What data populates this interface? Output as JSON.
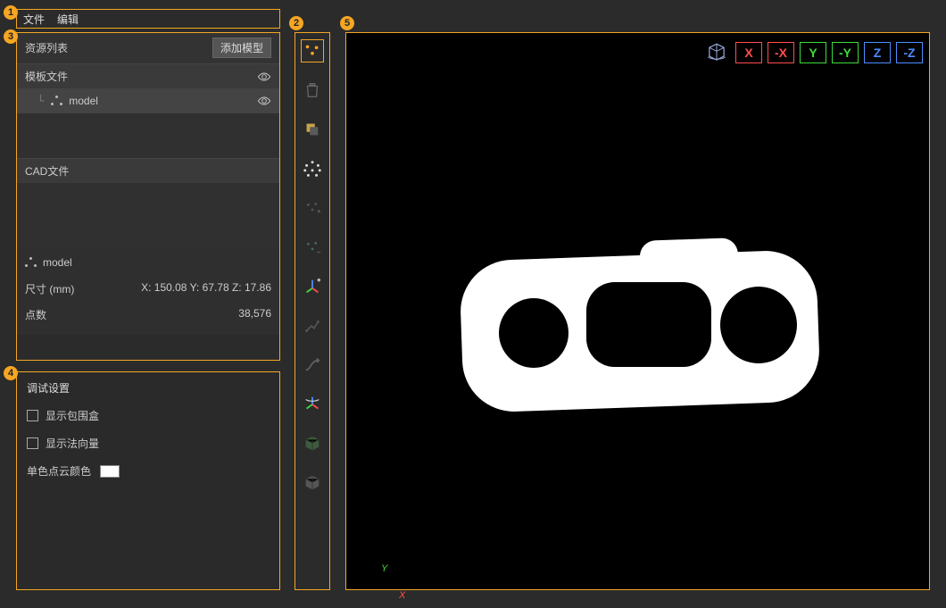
{
  "callouts": {
    "c1": "1",
    "c2": "2",
    "c3": "3",
    "c4": "4",
    "c5": "5"
  },
  "menu": {
    "file": "文件",
    "edit": "编辑"
  },
  "resource": {
    "title": "资源列表",
    "addBtn": "添加模型",
    "templatesHeader": "模板文件",
    "modelItem": "model",
    "cadHeader": "CAD文件"
  },
  "info": {
    "modelName": "model",
    "sizeLabel": "尺寸 (mm)",
    "sizeValue": "X: 150.08 Y: 67.78 Z: 17.86",
    "pointsLabel": "点数",
    "pointsValue": "38,576"
  },
  "debug": {
    "title": "调试设置",
    "showBBox": "显示包围盒",
    "showNormals": "显示法向量",
    "monoColorLabel": "单色点云颜色",
    "monoColor": "#ffffff"
  },
  "toolbarIcons": [
    "select-points",
    "trash",
    "layer",
    "sample-sparse",
    "add-points",
    "subtract-points",
    "axes-add",
    "transform",
    "curve",
    "axes-orbit",
    "cube-solid",
    "cube-wire"
  ],
  "axes": {
    "cube": "orbit-cube",
    "buttons": [
      {
        "k": "X",
        "cls": "axX"
      },
      {
        "k": "-X",
        "cls": "axX"
      },
      {
        "k": "Y",
        "cls": "axY"
      },
      {
        "k": "-Y",
        "cls": "axY"
      },
      {
        "k": "Z",
        "cls": "axZ"
      },
      {
        "k": "-Z",
        "cls": "axZ"
      }
    ]
  },
  "gizmo": {
    "y": "Y",
    "x": "X"
  }
}
